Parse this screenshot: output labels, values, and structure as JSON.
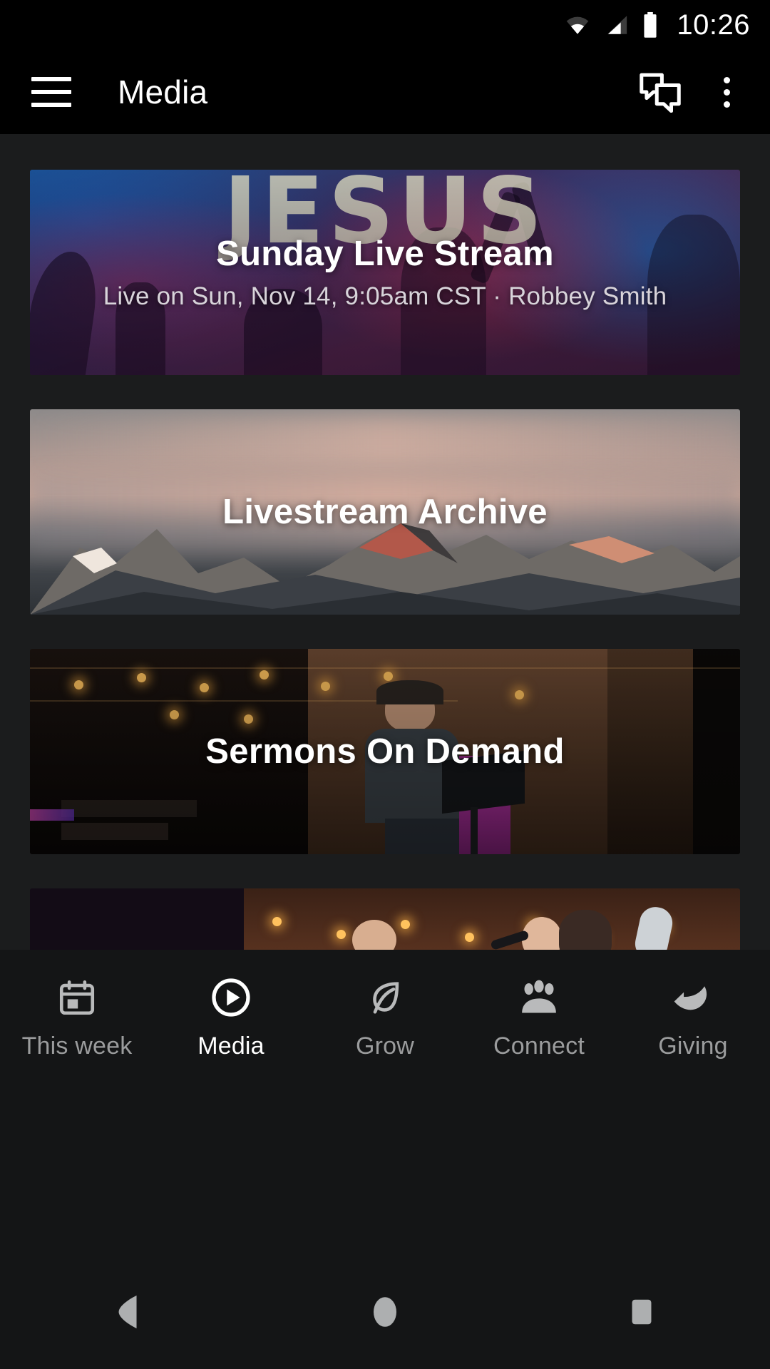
{
  "status_bar": {
    "time": "10:26",
    "icons": [
      "wifi-icon",
      "cellular-signal-icon",
      "battery-icon"
    ]
  },
  "app_bar": {
    "menu_icon": "hamburger-menu-icon",
    "title": "Media",
    "chat_icon": "chat-bubbles-icon",
    "overflow_icon": "overflow-menu-icon"
  },
  "cards": [
    {
      "title": "Sunday Live Stream",
      "subtitle": "Live on Sun, Nov 14, 9:05am CST · Robbey Smith",
      "art_text": "JESUS",
      "art_name": "worship-concert-artwork"
    },
    {
      "title": "Livestream Archive",
      "subtitle": "",
      "art_name": "mountain-range-artwork"
    },
    {
      "title": "Sermons On Demand",
      "subtitle": "",
      "art_name": "speaker-on-stage-artwork"
    },
    {
      "title": "",
      "subtitle": "",
      "art_name": "worship-singers-artwork"
    }
  ],
  "bottom_nav": {
    "items": [
      {
        "label": "This week",
        "icon": "calendar-icon",
        "active": false
      },
      {
        "label": "Media",
        "icon": "play-circle-icon",
        "active": true
      },
      {
        "label": "Grow",
        "icon": "leaf-icon",
        "active": false
      },
      {
        "label": "Connect",
        "icon": "people-group-icon",
        "active": false
      },
      {
        "label": "Giving",
        "icon": "giving-hand-icon",
        "active": false
      }
    ]
  },
  "system_bar": {
    "back": "back-triangle-icon",
    "home": "home-circle-icon",
    "recents": "recents-square-icon"
  },
  "colors": {
    "background": "#1b1c1d",
    "app_bar": "#000000",
    "nav_background": "#141516",
    "active_text": "#ffffff",
    "inactive_text": "#9b9c9d"
  }
}
